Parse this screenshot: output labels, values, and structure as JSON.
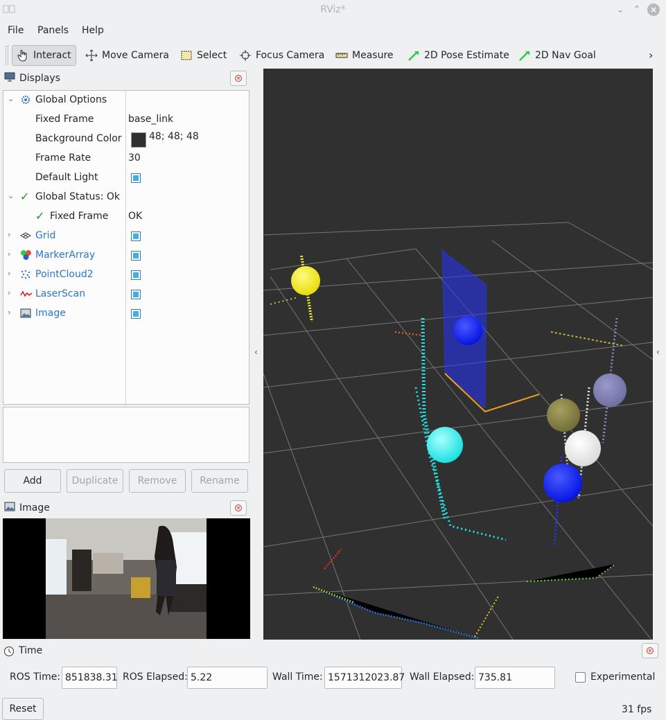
{
  "window": {
    "title": "RViz*",
    "icon": "rviz-icon"
  },
  "menu": {
    "items": [
      "File",
      "Panels",
      "Help"
    ]
  },
  "toolbar": {
    "tools": [
      {
        "label": "Interact",
        "icon": "hand-icon",
        "active": true
      },
      {
        "label": "Move Camera",
        "icon": "move-camera-icon"
      },
      {
        "label": "Select",
        "icon": "select-icon"
      },
      {
        "label": "Focus Camera",
        "icon": "focus-camera-icon"
      },
      {
        "label": "Measure",
        "icon": "ruler-icon"
      },
      {
        "label": "2D Pose Estimate",
        "icon": "pose-arrow-icon"
      },
      {
        "label": "2D Nav Goal",
        "icon": "nav-goal-arrow-icon"
      }
    ],
    "overflow_icon": "chevron-right-icon"
  },
  "displays": {
    "title": "Displays",
    "rows": [
      {
        "label": "Global Options",
        "icon": "gear-icon",
        "value": ""
      },
      {
        "label": "Fixed Frame",
        "value": "base_link"
      },
      {
        "label": "Background Color",
        "value": "48; 48; 48",
        "color": "#303030"
      },
      {
        "label": "Frame Rate",
        "value": "30"
      },
      {
        "label": "Default Light",
        "checked": true
      },
      {
        "label": "Global Status: Ok",
        "icon": "check-icon"
      },
      {
        "label": "Fixed Frame",
        "value": "OK",
        "icon": "check-icon"
      },
      {
        "label": "Grid",
        "icon": "grid-icon",
        "checked": true
      },
      {
        "label": "MarkerArray",
        "icon": "marker-array-icon",
        "checked": true
      },
      {
        "label": "PointCloud2",
        "icon": "pointcloud-icon",
        "checked": true
      },
      {
        "label": "LaserScan",
        "icon": "laserscan-icon",
        "checked": true
      },
      {
        "label": "Image",
        "icon": "image-icon",
        "checked": true
      }
    ],
    "buttons": {
      "add": "Add",
      "duplicate": "Duplicate",
      "remove": "Remove",
      "rename": "Rename"
    }
  },
  "image_panel": {
    "title": "Image"
  },
  "time": {
    "title": "Time",
    "ros_time_label": "ROS Time:",
    "ros_time": "851838.31",
    "ros_elapsed_label": "ROS Elapsed:",
    "ros_elapsed": "5.22",
    "wall_time_label": "Wall Time:",
    "wall_time": "1571312023.87",
    "wall_elapsed_label": "Wall Elapsed:",
    "wall_elapsed": "735.81",
    "experimental_label": "Experimental",
    "experimental_checked": false
  },
  "status": {
    "reset_label": "Reset",
    "fps": "31 fps"
  },
  "colors": {
    "viewport_bg": "#303030",
    "accent": "#3daee9",
    "link_blue": "#2a78c8"
  }
}
